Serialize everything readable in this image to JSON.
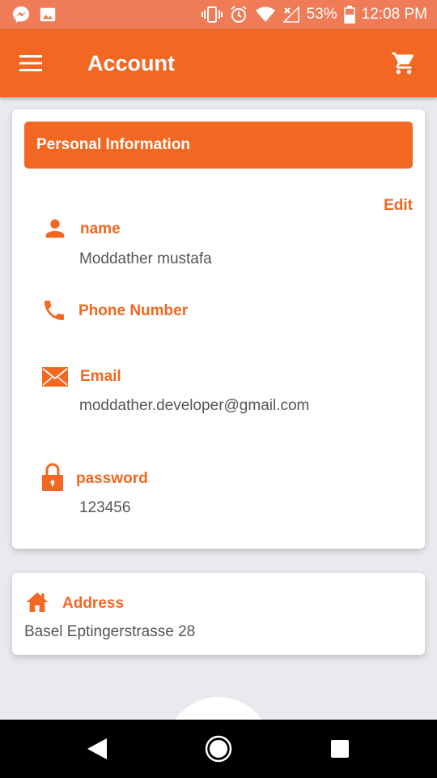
{
  "status_bar": {
    "battery_percent": "53%",
    "time": "12:08 PM",
    "icons": [
      "messenger-icon",
      "image-icon",
      "vibrate-icon",
      "alarm-icon",
      "wifi-icon",
      "signal-icon",
      "battery-icon"
    ]
  },
  "app_bar": {
    "title": "Account",
    "menu_icon": "hamburger-menu-icon",
    "cart_icon": "shopping-cart-icon"
  },
  "personal_info": {
    "header": "Personal Information",
    "edit_label": "Edit",
    "fields": {
      "name": {
        "label": "name",
        "value": "Moddather mustafa",
        "icon": "person-icon"
      },
      "phone": {
        "label": "Phone Number",
        "value": "",
        "icon": "phone-icon"
      },
      "email": {
        "label": "Email",
        "value": "moddather.developer@gmail.com",
        "icon": "mail-icon"
      },
      "password": {
        "label": "password",
        "value": "123456",
        "icon": "lock-icon"
      }
    }
  },
  "address": {
    "label": "Address",
    "value": "Basel Eptingerstrasse 28",
    "icon": "home-icon"
  },
  "nav_bar": {
    "buttons": [
      "back-icon",
      "home-circle-icon",
      "recents-icon"
    ]
  },
  "colors": {
    "accent": "#f26722",
    "status_bar": "#f07c57",
    "background": "#e9e9ee",
    "text_gray": "#555555"
  }
}
